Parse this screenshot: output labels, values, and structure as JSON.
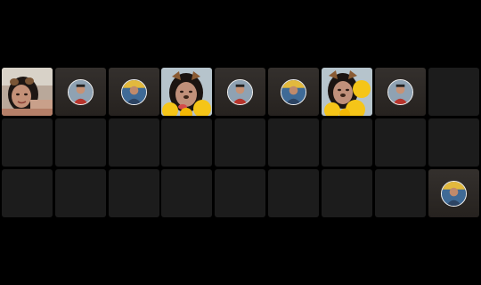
{
  "colors": {
    "background": "#000000",
    "tile_empty": "#1c1c1c",
    "tile_filled": "#2e2a27",
    "avatar_ring": "#f2f2f2",
    "filter_yellow": "#f5c518"
  },
  "panels": [
    {
      "tiles": [
        {
          "kind": "camera",
          "icon": "user-video-feed"
        },
        {
          "kind": "avatar",
          "icon": "user-avatar-red-shirt"
        },
        {
          "kind": "avatar",
          "icon": "user-avatar-flag"
        },
        {
          "kind": "empty"
        },
        {
          "kind": "empty"
        },
        {
          "kind": "empty"
        },
        {
          "kind": "empty"
        },
        {
          "kind": "empty"
        },
        {
          "kind": "empty"
        }
      ]
    },
    {
      "tiles": [
        {
          "kind": "camera",
          "icon": "user-video-feed-dog-filter"
        },
        {
          "kind": "avatar",
          "icon": "user-avatar-red-shirt"
        },
        {
          "kind": "avatar",
          "icon": "user-avatar-flag"
        },
        {
          "kind": "empty"
        },
        {
          "kind": "empty"
        },
        {
          "kind": "empty"
        },
        {
          "kind": "empty"
        },
        {
          "kind": "empty"
        },
        {
          "kind": "empty"
        }
      ]
    },
    {
      "tiles": [
        {
          "kind": "camera",
          "icon": "user-video-feed-dog-filter"
        },
        {
          "kind": "avatar",
          "icon": "user-avatar-red-shirt"
        },
        {
          "kind": "empty"
        },
        {
          "kind": "empty"
        },
        {
          "kind": "empty"
        },
        {
          "kind": "empty"
        },
        {
          "kind": "empty"
        },
        {
          "kind": "empty"
        },
        {
          "kind": "avatar",
          "icon": "user-avatar-flag"
        }
      ]
    }
  ]
}
